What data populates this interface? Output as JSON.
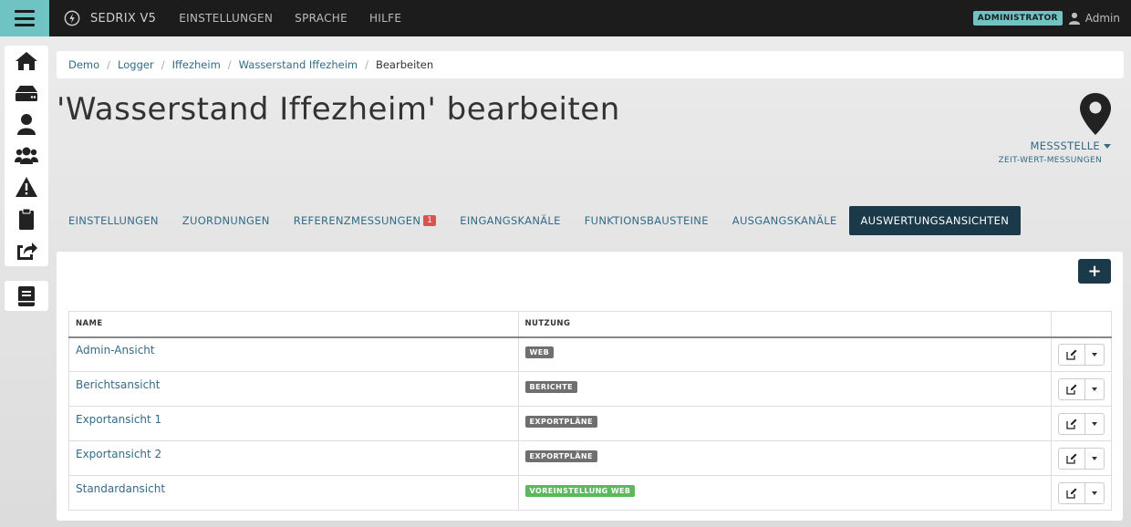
{
  "navbar": {
    "brand": "SEDRIX V5",
    "items": [
      {
        "label": "EINSTELLUNGEN"
      },
      {
        "label": "SPRACHE"
      },
      {
        "label": "HILFE"
      }
    ],
    "role_badge": "ADMINISTRATOR",
    "user_name": "Admin"
  },
  "sidebar": {
    "items": [
      {
        "icon": "home-icon"
      },
      {
        "icon": "server-icon"
      },
      {
        "icon": "user-icon"
      },
      {
        "icon": "users-icon"
      },
      {
        "icon": "warning-icon"
      },
      {
        "icon": "clipboard-icon"
      },
      {
        "icon": "share-icon"
      }
    ],
    "extra_icon": "book-icon"
  },
  "breadcrumb": {
    "items": [
      "Demo",
      "Logger",
      "Iffezheim",
      "Wasserstand Iffezheim"
    ],
    "active": "Bearbeiten"
  },
  "page": {
    "title": "'Wasserstand Iffezheim' bearbeiten",
    "type_label": "MESSSTELLE",
    "type_sub": "ZEIT-WERT-MESSUNGEN"
  },
  "tabs": [
    {
      "label": "EINSTELLUNGEN"
    },
    {
      "label": "ZUORDNUNGEN"
    },
    {
      "label": "REFERENZMESSUNGEN",
      "badge": "1"
    },
    {
      "label": "EINGANGSKANÄLE"
    },
    {
      "label": "FUNKTIONSBAUSTEINE"
    },
    {
      "label": "AUSGANGSKANÄLE"
    },
    {
      "label": "AUSWERTUNGSANSICHTEN",
      "active": true
    }
  ],
  "table": {
    "add_label": "+",
    "headers": {
      "name": "NAME",
      "usage": "NUTZUNG"
    },
    "rows": [
      {
        "name": "Admin-Ansicht",
        "usage": "WEB",
        "usage_color": "#6f6f6f"
      },
      {
        "name": "Berichtsansicht",
        "usage": "BERICHTE",
        "usage_color": "#6f6f6f"
      },
      {
        "name": "Exportansicht 1",
        "usage": "EXPORTPLÄNE",
        "usage_color": "#6f6f6f"
      },
      {
        "name": "Exportansicht 2",
        "usage": "EXPORTPLÄNE",
        "usage_color": "#6f6f6f"
      },
      {
        "name": "Standardansicht",
        "usage": "VOREINSTELLUNG WEB",
        "usage_color": "#5cb85c"
      }
    ]
  },
  "colors": {
    "accent": "#6fc3c3",
    "primary_dark": "#1a3a4a",
    "link": "#336b87",
    "danger": "#d9534f",
    "success": "#5cb85c"
  }
}
